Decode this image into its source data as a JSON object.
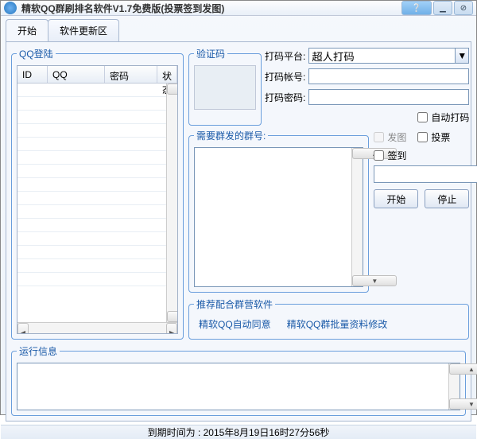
{
  "window": {
    "title": "精软QQ群刷排名软件V1.7免费版(投票签到发图)"
  },
  "tabs": {
    "start": "开始",
    "update": "软件更新区"
  },
  "login": {
    "legend": "QQ登陆",
    "cols": {
      "id": "ID",
      "qq": "QQ",
      "pwd": "密码",
      "status": "状态"
    }
  },
  "captcha": {
    "legend": "验证码"
  },
  "platform": {
    "label": "打码平台:",
    "value": "超人打码",
    "account_label": "打码帐号:",
    "account_value": "",
    "password_label": "打码密码:",
    "password_value": "",
    "auto_label": "自动打码"
  },
  "group": {
    "legend": "需要群发的群号:",
    "value": ""
  },
  "options": {
    "send_img": "发图",
    "vote": "投票",
    "checkin": "签到",
    "path_value": "",
    "browse": "...",
    "start": "开始",
    "stop": "停止"
  },
  "recommend": {
    "legend": "推荐配合群营软件",
    "link1": "精软QQ自动同意",
    "link2": "精软QQ群批量资料修改"
  },
  "runinfo": {
    "legend": "运行信息",
    "value": ""
  },
  "footer": {
    "text": "到期时间为 : 2015年8月19日16时27分56秒"
  }
}
